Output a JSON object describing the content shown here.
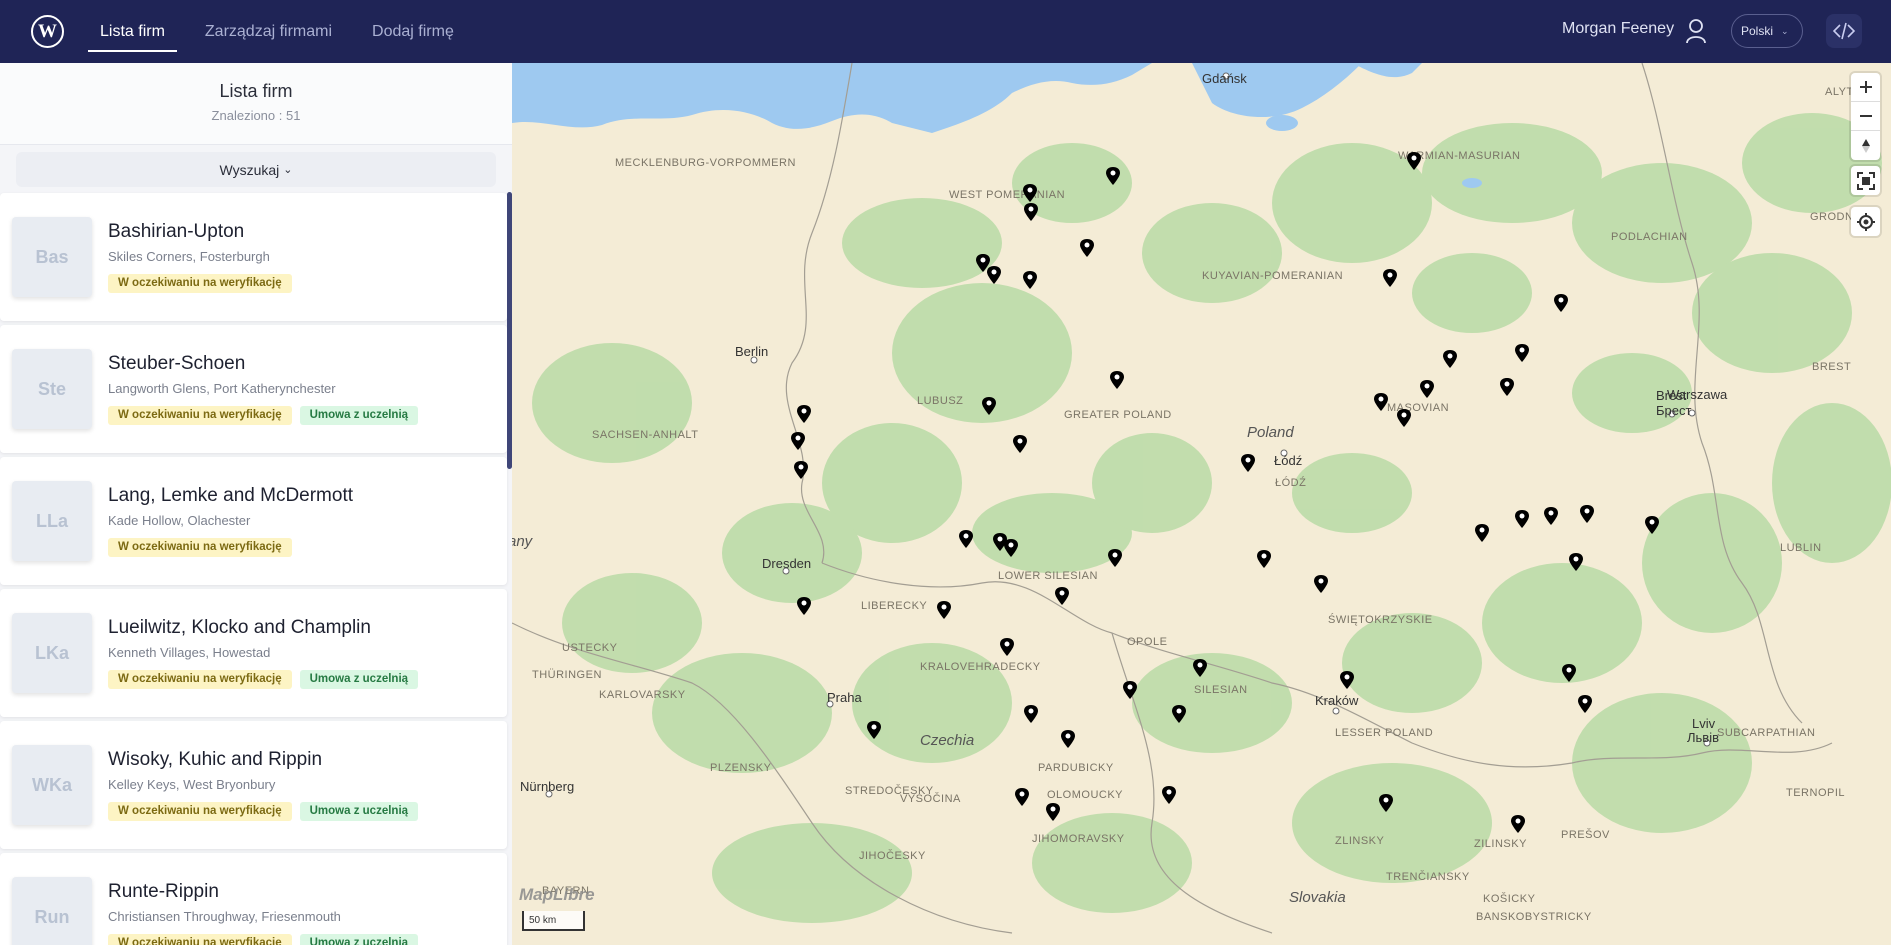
{
  "header": {
    "logo_letter": "W",
    "nav": [
      {
        "label": "Lista firm",
        "active": true
      },
      {
        "label": "Zarządzaj firmami",
        "active": false
      },
      {
        "label": "Dodaj firmę",
        "active": false
      }
    ],
    "user_name": "Morgan Feeney",
    "language": "Polski"
  },
  "sidebar": {
    "title": "Lista firm",
    "count": "Znaleziono : 51",
    "search_label": "Wyszukaj",
    "companies": [
      {
        "initials": "Bas",
        "name": "Bashirian-Upton",
        "address": "Skiles Corners, Fosterburgh",
        "badges": [
          "W oczekiwaniu na weryfikację"
        ]
      },
      {
        "initials": "Ste",
        "name": "Steuber-Schoen",
        "address": "Langworth Glens, Port Katherynchester",
        "badges": [
          "W oczekiwaniu na weryfikację",
          "Umowa z uczelnią"
        ]
      },
      {
        "initials": "LLa",
        "name": "Lang, Lemke and McDermott",
        "address": "Kade Hollow, Olachester",
        "badges": [
          "W oczekiwaniu na weryfikację"
        ]
      },
      {
        "initials": "LKa",
        "name": "Lueilwitz, Klocko and Champlin",
        "address": "Kenneth Villages, Howestad",
        "badges": [
          "W oczekiwaniu na weryfikację",
          "Umowa z uczelnią"
        ]
      },
      {
        "initials": "WKa",
        "name": "Wisoky, Kuhic and Rippin",
        "address": "Kelley Keys, West Bryonbury",
        "badges": [
          "W oczekiwaniu na weryfikację",
          "Umowa z uczelnią"
        ]
      },
      {
        "initials": "Run",
        "name": "Runte-Rippin",
        "address": "Christiansen Throughway, Friesenmouth",
        "badges": [
          "W oczekiwaniu na weryfikację",
          "Umowa z uczelnią"
        ]
      }
    ]
  },
  "map": {
    "region_labels": [
      "MECKLENBURG-VORPOMMERN",
      "WEST POMERANIAN",
      "WARMIAN-MASURIAN",
      "KUYAVIAN-POMERANIAN",
      "PODLACHIAN",
      "LUBUSZ",
      "GREATER POLAND",
      "SACHSEN-ANHALT",
      "ŁÓDŹ",
      "MASOVIAN",
      "LOWER SILESIAN",
      "ŚWIĘTOKRZYSKIE",
      "LIBERECKY",
      "USTECKY",
      "OPOLE",
      "KRALOVEHRADECKY",
      "SILESIAN",
      "THÜRINGEN",
      "KARLOVARSKY",
      "LESSER POLAND",
      "SUBCARPATHIAN",
      "PARDUBICKY",
      "STREDOČESKY",
      "OLOMOUCKY",
      "PLZENSKY",
      "VYSOČINA",
      "ZLINSKY",
      "ZILINSKY",
      "PREŠOV",
      "TERNOPIL",
      "JIHOMORAVSKY",
      "JIHOČESKY",
      "TRENČIANSKY",
      "BAYERN",
      "KOŠICKY",
      "BANSKOBYSTRICKY",
      "ALYTAUS",
      "GRODNO",
      "BREST",
      "LUBLIN"
    ],
    "cities": [
      "Gdańsk",
      "Berlin",
      "Warszawa",
      "Łódź",
      "Dresden",
      "Praha",
      "Kraków",
      "Nürnberg",
      "Brest",
      "Брест",
      "Lviv",
      "Львів"
    ],
    "countries": [
      "Poland",
      "Czechia",
      "Slovakia",
      "any"
    ],
    "scale_label": "50 km",
    "attribution": "MapLibre",
    "controls": [
      "zoom-in",
      "zoom-out",
      "reset-north",
      "fullscreen",
      "geolocate"
    ]
  }
}
